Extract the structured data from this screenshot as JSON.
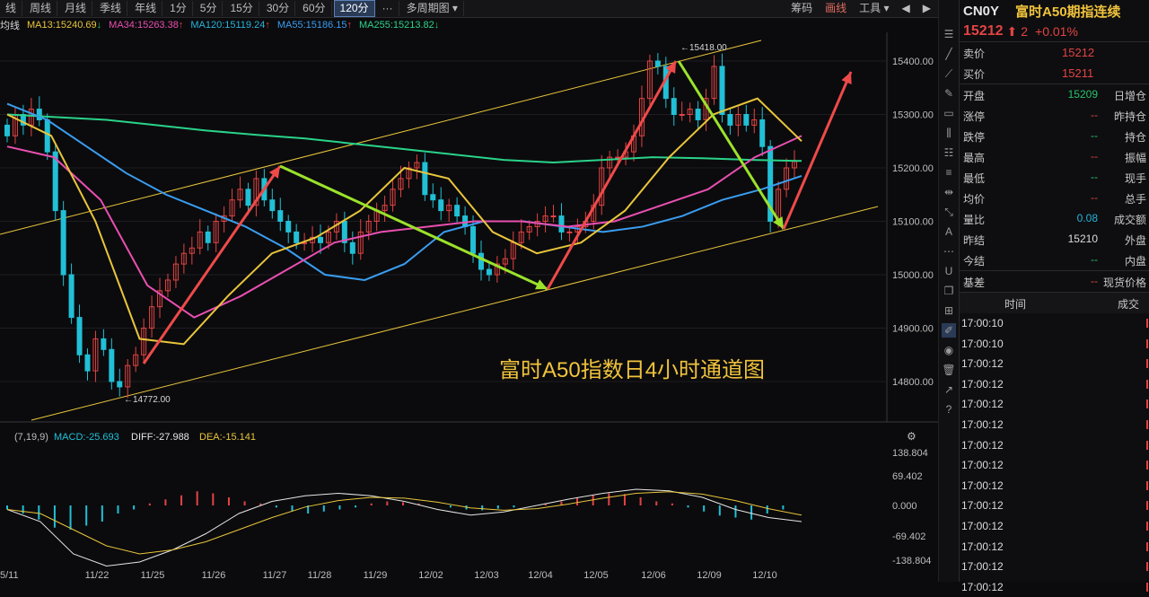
{
  "toolbar": {
    "tabs": [
      "周线",
      "月线",
      "季线",
      "年线",
      "1分",
      "5分",
      "15分",
      "30分",
      "60分",
      "120分",
      "···",
      "多周期图 ▾"
    ],
    "first_tab": "线",
    "active_tab": "120分",
    "right": [
      "筹码",
      "画线",
      "工具 ▾"
    ]
  },
  "ma_line": {
    "label": "均线",
    "items": [
      {
        "text": "MA13:15240.69",
        "arrow": "↓",
        "color": "#e8c53b"
      },
      {
        "text": "MA34:15263.38",
        "arrow": "↑",
        "color": "#e84fb0"
      },
      {
        "text": "MA120:15119.24",
        "arrow": "↑",
        "color": "#27b3d8"
      },
      {
        "text": "MA55:15186.15",
        "arrow": "↑",
        "color": "#3a9df0"
      },
      {
        "text": "MA255:15213.82",
        "arrow": "↓",
        "color": "#2ad38a"
      }
    ]
  },
  "chart_data": {
    "type": "candlestick",
    "title": "富时A50指数日4小时通道图",
    "y_ticks": [
      "15400.00",
      "15300.00",
      "15200.00",
      "15100.00",
      "15000.00",
      "14900.00",
      "14800.00"
    ],
    "high_label": "15418.00",
    "low_label": "14772.00",
    "x_labels": [
      "5/11",
      "11/22",
      "11/25",
      "11/26",
      "11/27",
      "11/28",
      "11/29",
      "12/02",
      "12/03",
      "12/04",
      "12/05",
      "12/06",
      "12/09",
      "12/10"
    ],
    "macd": {
      "header": "(7,19,9)",
      "macd_text": "MACD:-25.693",
      "diff_text": "DIFF:-27.988",
      "dea_text": "DEA:-15.141",
      "y_ticks": [
        "138.804",
        "69.402",
        "0.000",
        "-69.402",
        "-138.804"
      ]
    }
  },
  "quote": {
    "code": "CN0Y",
    "name": "富时A50期指连续",
    "price": "15212",
    "change": "2",
    "pct": "+0.01%",
    "sell_label": "卖价",
    "sell": "15212",
    "buy_label": "买价",
    "buy": "15211",
    "rows": [
      {
        "l": "开盘",
        "v": "15209",
        "c": "#27c26b",
        "r": "日增仓"
      },
      {
        "l": "涨停",
        "v": "--",
        "c": "#e34343",
        "r": "昨持仓"
      },
      {
        "l": "跌停",
        "v": "--",
        "c": "#27c26b",
        "r": "持仓"
      },
      {
        "l": "最高",
        "v": "--",
        "c": "#e34343",
        "r": "振幅"
      },
      {
        "l": "最低",
        "v": "--",
        "c": "#27c26b",
        "r": "现手"
      },
      {
        "l": "均价",
        "v": "--",
        "c": "#e34343",
        "r": "总手"
      },
      {
        "l": "量比",
        "v": "0.08",
        "c": "#27b3d8",
        "r": "成交额"
      },
      {
        "l": "昨结",
        "v": "15210",
        "c": "#dcdcdc",
        "r": "外盘"
      },
      {
        "l": "今结",
        "v": "--",
        "c": "#27c26b",
        "r": "内盘"
      }
    ],
    "basis_label": "基差",
    "basis": "--",
    "spot_label": "现货价格",
    "time_header": "时间",
    "deal_header": "成交",
    "times": [
      "17:00:10",
      "17:00:10",
      "17:00:12",
      "17:00:12",
      "17:00:12",
      "17:00:12",
      "17:00:12",
      "17:00:12",
      "17:00:12",
      "17:00:12",
      "17:00:12",
      "17:00:12",
      "17:00:12",
      "17:00:12"
    ]
  }
}
